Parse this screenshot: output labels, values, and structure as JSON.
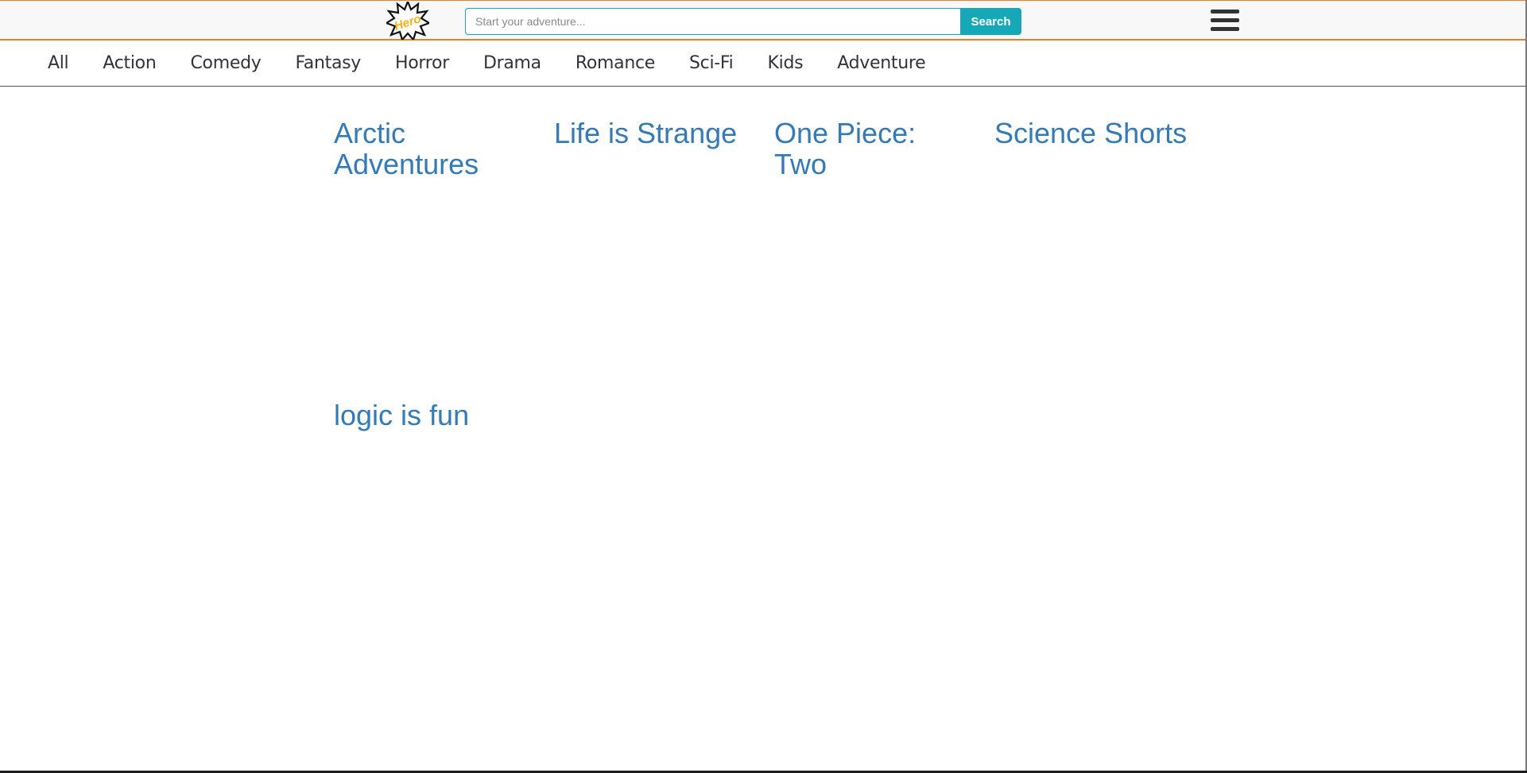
{
  "header": {
    "logo_text": "Hero",
    "search": {
      "placeholder": "Start your adventure...",
      "value": "",
      "button_label": "Search"
    },
    "menu_icon": "hamburger-menu-icon"
  },
  "categories": [
    {
      "label": "All"
    },
    {
      "label": "Action"
    },
    {
      "label": "Comedy"
    },
    {
      "label": "Fantasy"
    },
    {
      "label": "Horror"
    },
    {
      "label": "Drama"
    },
    {
      "label": "Romance"
    },
    {
      "label": "Sci-Fi"
    },
    {
      "label": "Kids"
    },
    {
      "label": "Adventure"
    }
  ],
  "stories": [
    {
      "title": "Arctic Adventures"
    },
    {
      "title": "Life is Strange"
    },
    {
      "title": "One Piece: Two"
    },
    {
      "title": "Science Shorts"
    },
    {
      "title": "logic is fun"
    }
  ],
  "colors": {
    "accent_orange": "#e8802a",
    "search_button": "#17a8b8",
    "link_blue": "#337ab7",
    "logo_yellow": "#f6b21a"
  }
}
